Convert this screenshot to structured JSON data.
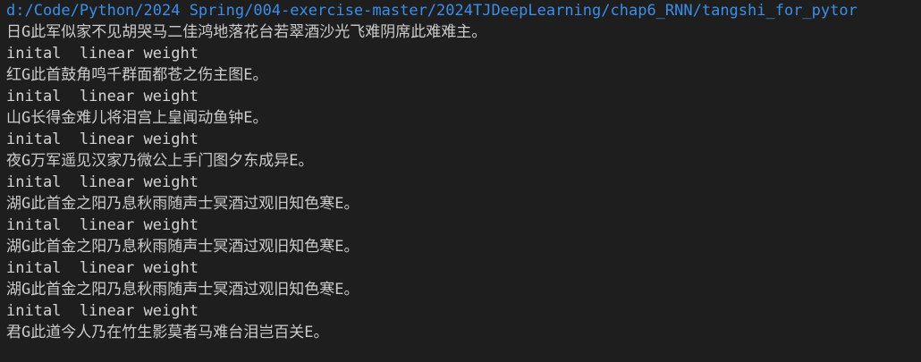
{
  "terminal": {
    "path_line": "d:/Code/Python/2024 Spring/004-exercise-master/2024TJDeepLearning/chap6_RNN/tangshi_for_pytor",
    "lines": [
      "日G此军似家不见胡哭马二佳鸿地落花台若翠酒沙光飞难阴席此难难主。",
      "inital  linear weight",
      "红G此首鼓角鸣千群面都苍之伤主图E。",
      "inital  linear weight",
      "山G长得金难儿将泪宫上皇闻动鱼钟E。",
      "inital  linear weight",
      "夜G万军遥见汉家乃微公上手门图夕东成异E。",
      "inital  linear weight",
      "湖G此首金之阳乃息秋雨随声士冥酒过观旧知色寒E。",
      "inital  linear weight",
      "湖G此首金之阳乃息秋雨随声士冥酒过观旧知色寒E。",
      "inital  linear weight",
      "湖G此首金之阳乃息秋雨随声士冥酒过观旧知色寒E。",
      "inital  linear weight",
      "君G此道今人乃在竹生影莫者马难台泪岂百关E。"
    ],
    "colors": {
      "background": "#1e1e1e",
      "path": "#3b8eea",
      "text": "#cccccc"
    }
  }
}
